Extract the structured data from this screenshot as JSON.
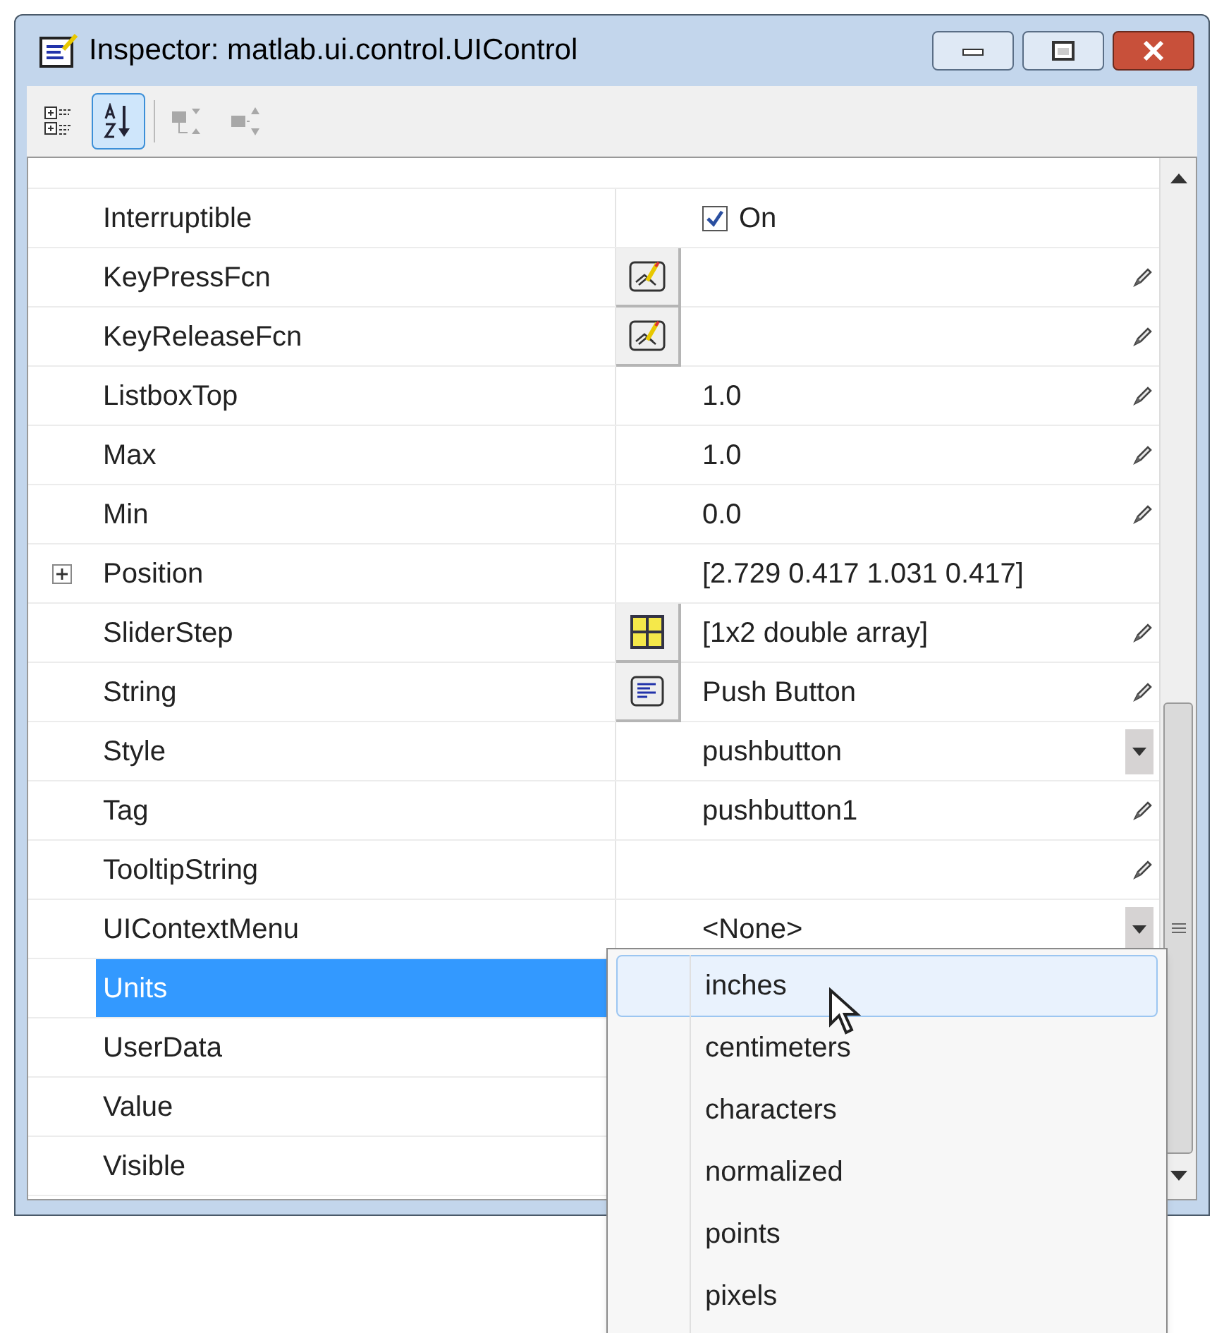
{
  "window": {
    "title": "Inspector:  matlab.ui.control.UIControl"
  },
  "toolbar": [
    {
      "kind": "categorized",
      "selected": false,
      "disabled": false
    },
    {
      "kind": "alphabetical",
      "selected": true,
      "disabled": false
    },
    {
      "kind": "expand",
      "selected": false,
      "disabled": true
    },
    {
      "kind": "collapse",
      "selected": false,
      "disabled": true
    }
  ],
  "rows": [
    {
      "name": "Interruptible",
      "value": "On",
      "kind": "checkbox",
      "checked": true,
      "pencil": false,
      "dropdown": false,
      "selected": false
    },
    {
      "name": "KeyPressFcn",
      "kind": "text",
      "editor": {
        "kind": "callback"
      },
      "pencil": true,
      "dropdown": false,
      "selected": false
    },
    {
      "name": "KeyReleaseFcn",
      "kind": "text",
      "editor": {
        "kind": "callback"
      },
      "pencil": true,
      "dropdown": false,
      "selected": false
    },
    {
      "name": "ListboxTop",
      "value": "1.0",
      "kind": "text",
      "pencil": true,
      "dropdown": false,
      "selected": false
    },
    {
      "name": "Max",
      "value": "1.0",
      "kind": "text",
      "pencil": true,
      "dropdown": false,
      "selected": false
    },
    {
      "name": "Min",
      "value": "0.0",
      "kind": "text",
      "pencil": true,
      "dropdown": false,
      "selected": false
    },
    {
      "name": "Position",
      "value": "[2.729 0.417 1.031 0.417]",
      "kind": "group",
      "expanded": false,
      "pencil": false,
      "dropdown": false,
      "selected": false
    },
    {
      "name": "SliderStep",
      "value": "[1x2  double array]",
      "kind": "text",
      "editor": {
        "kind": "array"
      },
      "pencil": true,
      "dropdown": false,
      "selected": false
    },
    {
      "name": "String",
      "value": "Push Button",
      "kind": "text",
      "editor": {
        "kind": "text"
      },
      "pencil": true,
      "dropdown": false,
      "selected": false
    },
    {
      "name": "Style",
      "value": "pushbutton",
      "kind": "text",
      "pencil": false,
      "dropdown": true,
      "selected": false
    },
    {
      "name": "Tag",
      "value": "pushbutton1",
      "kind": "text",
      "pencil": true,
      "dropdown": false,
      "selected": false
    },
    {
      "name": "TooltipString",
      "kind": "text",
      "pencil": true,
      "dropdown": false,
      "selected": false
    },
    {
      "name": "UIContextMenu",
      "value": "<None>",
      "kind": "text",
      "pencil": false,
      "dropdown": true,
      "selected": false
    },
    {
      "name": "Units",
      "kind": "text",
      "selected": true
    },
    {
      "name": "UserData",
      "kind": "text",
      "selected": false
    },
    {
      "name": "Value",
      "kind": "text",
      "selected": false
    },
    {
      "name": "Visible",
      "kind": "text",
      "selected": false
    }
  ],
  "dropdown": {
    "options": [
      {
        "label": "inches",
        "selected": true
      },
      {
        "label": "centimeters",
        "selected": false
      },
      {
        "label": "characters",
        "selected": false
      },
      {
        "label": "normalized",
        "selected": false
      },
      {
        "label": "points",
        "selected": false
      },
      {
        "label": "pixels",
        "selected": false
      }
    ]
  }
}
